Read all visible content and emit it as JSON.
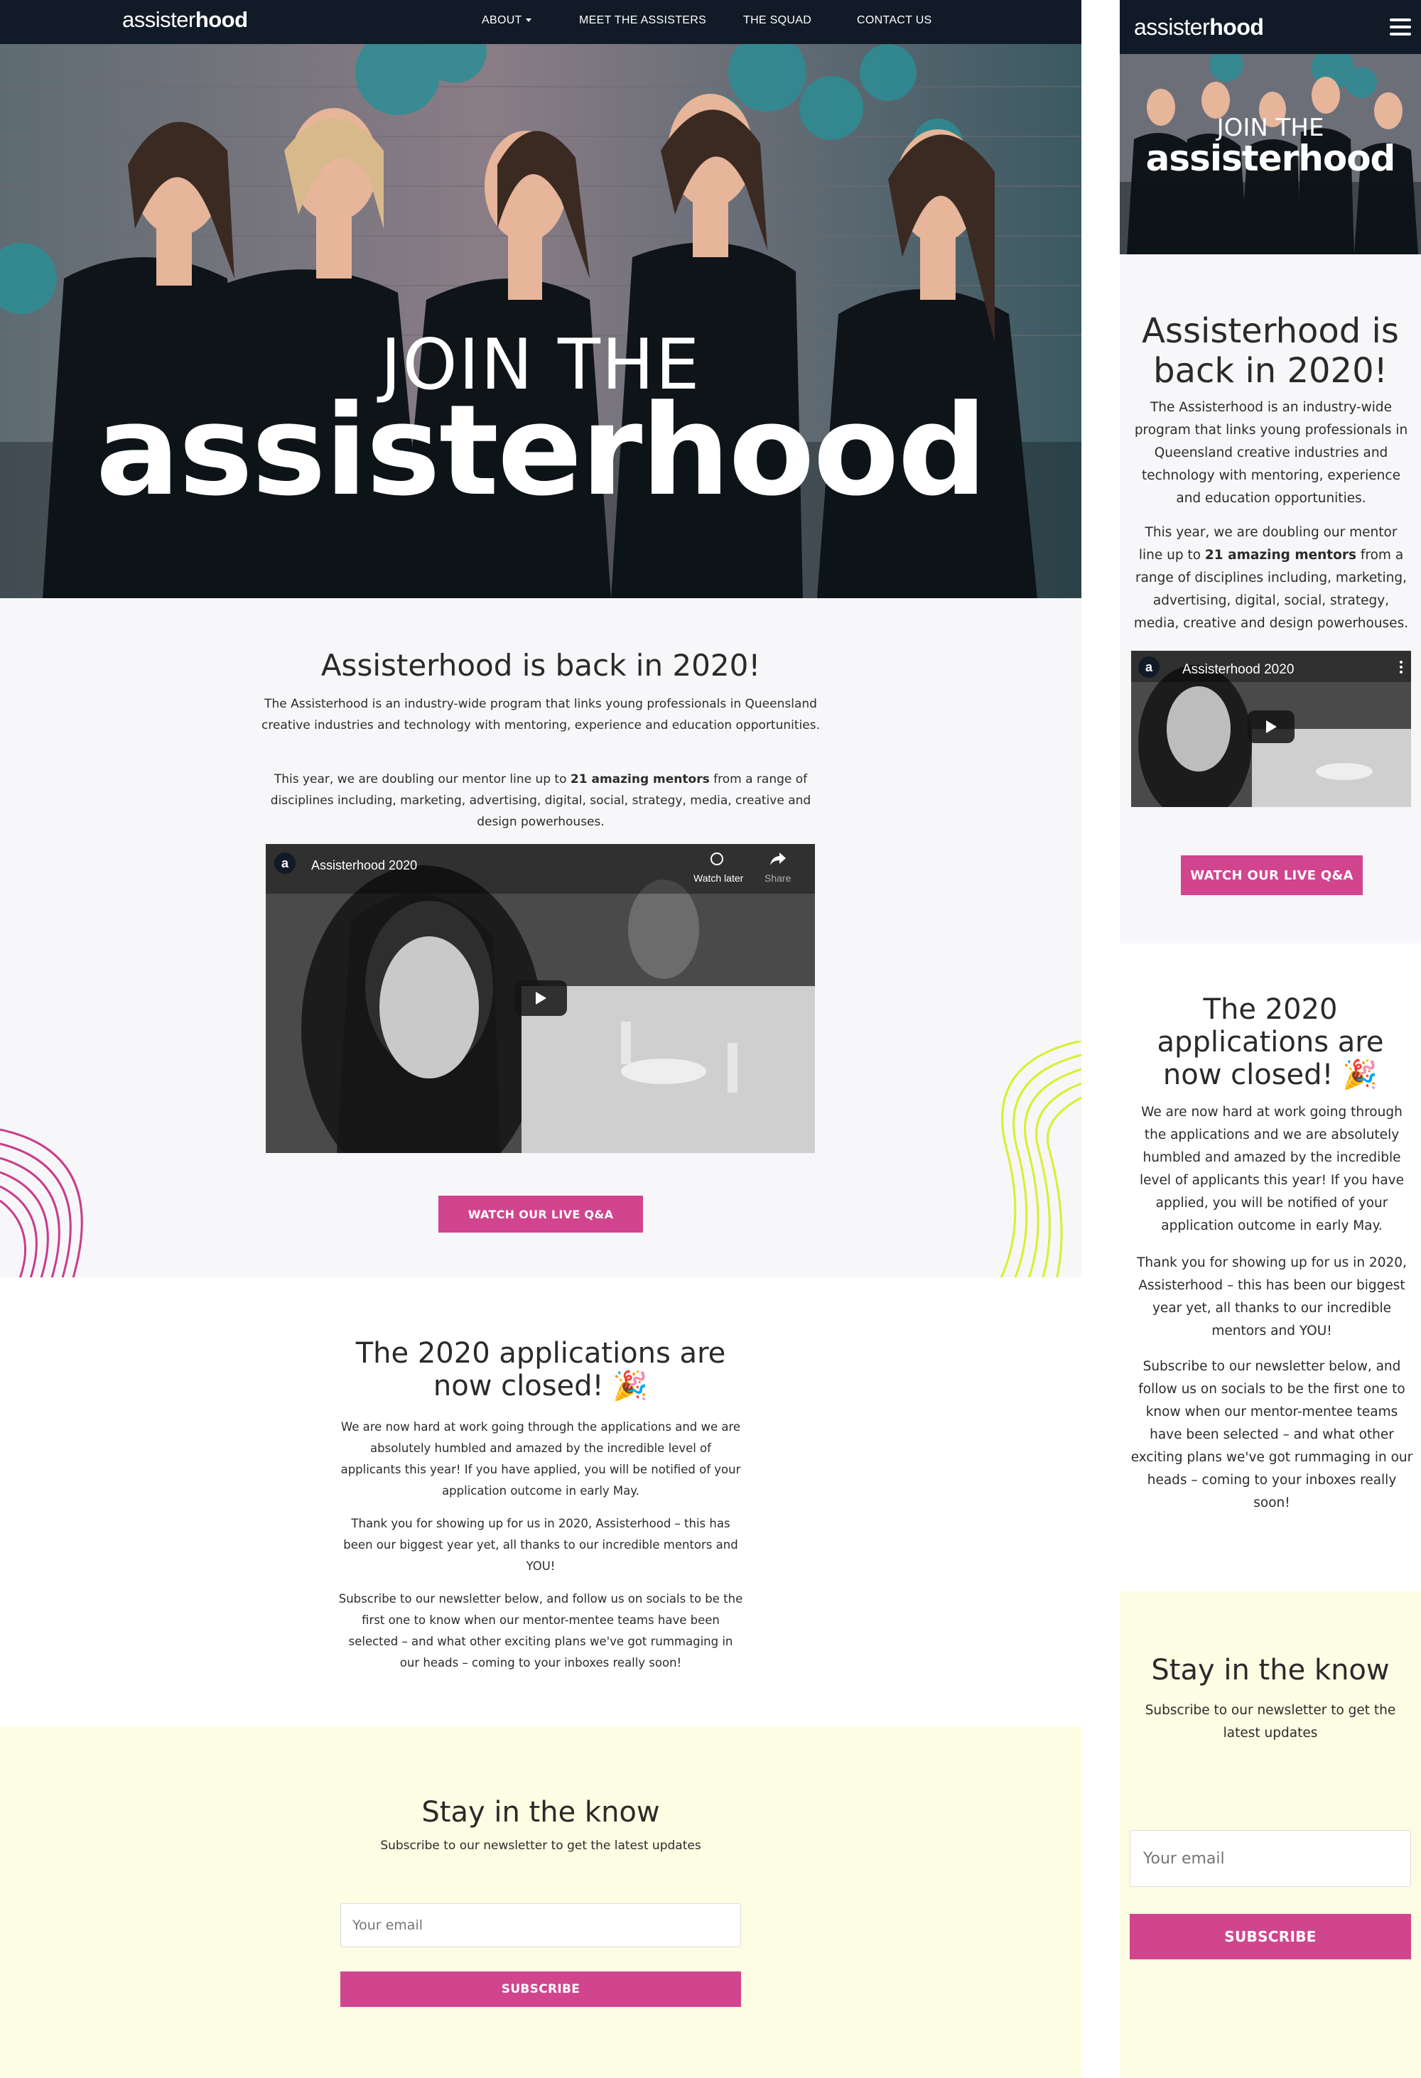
{
  "brand": {
    "logo_light": "assister",
    "logo_bold": "hood",
    "accent_pink": "#d1458f",
    "nav_bg": "#111b27",
    "yellow_bg": "#fcfde3"
  },
  "nav": {
    "items": [
      {
        "label": "ABOUT"
      },
      {
        "label": "MEET THE ASSISTERS"
      },
      {
        "label": "THE SQUAD"
      },
      {
        "label": "CONTACT US"
      }
    ],
    "menu_icon": "hamburger-icon"
  },
  "hero": {
    "line1": "JOIN THE",
    "line2": "assisterhood"
  },
  "intro": {
    "heading": "Assisterhood is back in 2020!",
    "para1": "The Assisterhood is an industry-wide program that links young professionals in Queensland creative industries and technology with mentoring, experience and education opportunities.",
    "para2_before": "This year, we are doubling our mentor line up to ",
    "para2_bold": "21 amazing mentors",
    "para2_after": " from a range of disciplines including, marketing, advertising, digital, social, strategy, media, creative and design powerhouses.",
    "video_title": "Assisterhood 2020",
    "video_avatar": "a",
    "watch_later": "Watch later",
    "share": "Share",
    "button": "WATCH OUR LIVE Q&A"
  },
  "applications": {
    "heading": "The 2020 applications are now closed! 🎉",
    "para1": "We are now hard at work going through the applications and we are absolutely humbled and amazed by the incredible level of applicants this year! If you have applied, you will be notified of your application outcome in early May.",
    "para2": "Thank you for showing up for us in 2020, Assisterhood – this has been our biggest year yet, all thanks to our incredible mentors and YOU!",
    "para3": "Subscribe to our newsletter below, and follow us on socials to be the first one to know when our mentor-mentee teams have been selected – and what other exciting plans we've got rummaging in our heads – coming to your inboxes really soon!"
  },
  "newsletter": {
    "heading": "Stay in the know",
    "subheading": "Subscribe to our newsletter to get the latest updates",
    "email_placeholder": "Your email",
    "button": "SUBSCRIBE"
  }
}
